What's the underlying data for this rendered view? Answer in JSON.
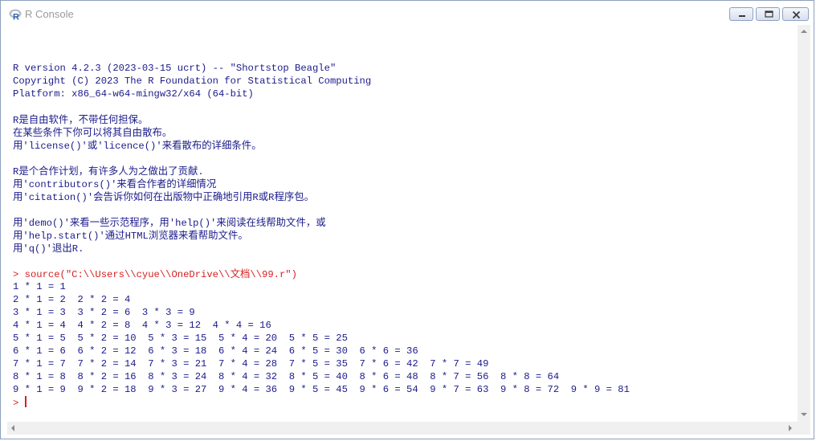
{
  "window": {
    "title": "R Console"
  },
  "console": {
    "lines": [
      {
        "kind": "gap",
        "text": ""
      },
      {
        "kind": "out",
        "text": "R version 4.2.3 (2023-03-15 ucrt) -- \"Shortstop Beagle\""
      },
      {
        "kind": "out",
        "text": "Copyright (C) 2023 The R Foundation for Statistical Computing"
      },
      {
        "kind": "out",
        "text": "Platform: x86_64-w64-mingw32/x64 (64-bit)"
      },
      {
        "kind": "gap",
        "text": ""
      },
      {
        "kind": "out",
        "text": "R是自由软件，不带任何担保。"
      },
      {
        "kind": "out",
        "text": "在某些条件下你可以将其自由散布。"
      },
      {
        "kind": "out",
        "text": "用'license()'或'licence()'来看散布的详细条件。"
      },
      {
        "kind": "gap",
        "text": ""
      },
      {
        "kind": "out",
        "text": "R是个合作计划，有许多人为之做出了贡献."
      },
      {
        "kind": "out",
        "text": "用'contributors()'来看合作者的详细情况"
      },
      {
        "kind": "out",
        "text": "用'citation()'会告诉你如何在出版物中正确地引用R或R程序包。"
      },
      {
        "kind": "gap",
        "text": ""
      },
      {
        "kind": "out",
        "text": "用'demo()'来看一些示范程序，用'help()'来阅读在线帮助文件，或"
      },
      {
        "kind": "out",
        "text": "用'help.start()'通过HTML浏览器来看帮助文件。"
      },
      {
        "kind": "out",
        "text": "用'q()'退出R."
      },
      {
        "kind": "gap",
        "text": ""
      },
      {
        "kind": "cmd",
        "text": "> source(\"C:\\\\Users\\\\cyue\\\\OneDrive\\\\文档\\\\99.r\")"
      },
      {
        "kind": "out",
        "text": "1 * 1 = 1"
      },
      {
        "kind": "out",
        "text": "2 * 1 = 2  2 * 2 = 4"
      },
      {
        "kind": "out",
        "text": "3 * 1 = 3  3 * 2 = 6  3 * 3 = 9"
      },
      {
        "kind": "out",
        "text": "4 * 1 = 4  4 * 2 = 8  4 * 3 = 12  4 * 4 = 16"
      },
      {
        "kind": "out",
        "text": "5 * 1 = 5  5 * 2 = 10  5 * 3 = 15  5 * 4 = 20  5 * 5 = 25"
      },
      {
        "kind": "out",
        "text": "6 * 1 = 6  6 * 2 = 12  6 * 3 = 18  6 * 4 = 24  6 * 5 = 30  6 * 6 = 36"
      },
      {
        "kind": "out",
        "text": "7 * 1 = 7  7 * 2 = 14  7 * 3 = 21  7 * 4 = 28  7 * 5 = 35  7 * 6 = 42  7 * 7 = 49"
      },
      {
        "kind": "out",
        "text": "8 * 1 = 8  8 * 2 = 16  8 * 3 = 24  8 * 4 = 32  8 * 5 = 40  8 * 6 = 48  8 * 7 = 56  8 * 8 = 64"
      },
      {
        "kind": "out",
        "text": "9 * 1 = 9  9 * 2 = 18  9 * 3 = 27  9 * 4 = 36  9 * 5 = 45  9 * 6 = 54  9 * 7 = 63  9 * 8 = 72  9 * 9 = 81"
      }
    ],
    "prompt": "> ",
    "colors": {
      "output": "#1b1b8a",
      "command": "#d52020"
    }
  },
  "icons": {
    "app": "r-logo-icon",
    "minimize": "minimize-icon",
    "maximize": "maximize-icon",
    "close": "close-icon"
  }
}
